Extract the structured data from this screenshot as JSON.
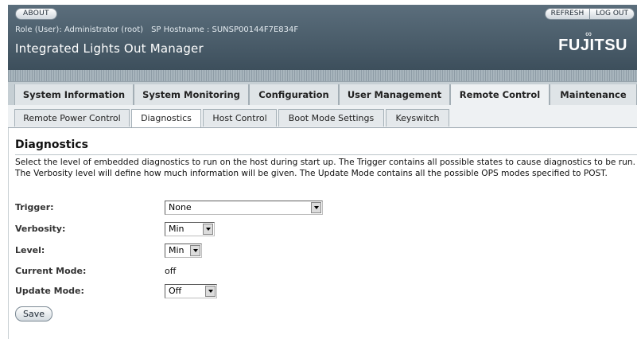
{
  "masthead": {
    "about_label": "ABOUT",
    "refresh_label": "REFRESH",
    "logout_label": "LOG OUT",
    "role_text": "Role (User): Administrator (root)",
    "hostname_text": "SP Hostname : SUNSP00144F7E834F",
    "app_title": "Integrated Lights Out Manager",
    "logo_text": "FUJITSU"
  },
  "primary_tabs": [
    {
      "label": "System Information"
    },
    {
      "label": "System Monitoring"
    },
    {
      "label": "Configuration"
    },
    {
      "label": "User Management"
    },
    {
      "label": "Remote Control"
    },
    {
      "label": "Maintenance"
    }
  ],
  "primary_active": "Remote Control",
  "secondary_tabs": [
    {
      "label": "Remote Power Control"
    },
    {
      "label": "Diagnostics"
    },
    {
      "label": "Host Control"
    },
    {
      "label": "Boot Mode Settings"
    },
    {
      "label": "Keyswitch"
    }
  ],
  "secondary_active": "Diagnostics",
  "page": {
    "title": "Diagnostics",
    "description": "Select the level of embedded diagnostics to run on the host during start up. The Trigger contains all possible states to cause diagnostics to be run. The Verbosity level will define how much information will be given. The Update Mode contains all the possible OPS modes specified to POST."
  },
  "form": {
    "trigger_label": "Trigger:",
    "trigger_value": "None",
    "verbosity_label": "Verbosity:",
    "verbosity_value": "Min",
    "level_label": "Level:",
    "level_value": "Min",
    "current_mode_label": "Current Mode:",
    "current_mode_value": "off",
    "update_mode_label": "Update Mode:",
    "update_mode_value": "Off",
    "save_label": "Save"
  },
  "colors": {
    "masthead": "#4a5c69",
    "tab_bar": "#c6cfd4",
    "active_tab": "#eef1f3"
  }
}
